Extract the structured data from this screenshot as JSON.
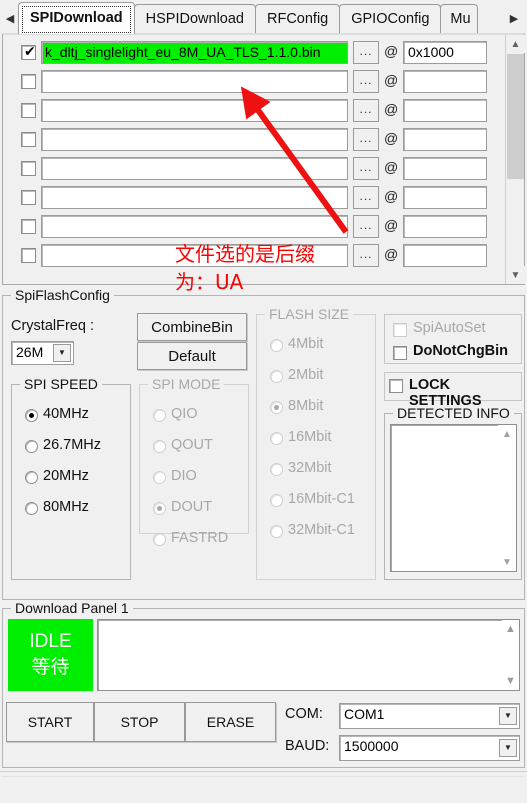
{
  "window": {
    "tab_scroll_left_icon": "triangle-left-icon",
    "tab_scroll_right_icon": "triangle-right-icon"
  },
  "tabs": [
    {
      "label": "SPIDownload",
      "active": true
    },
    {
      "label": "HSPIDownload",
      "active": false
    },
    {
      "label": "RFConfig",
      "active": false
    },
    {
      "label": "GPIOConfig",
      "active": false
    },
    {
      "label": "Mu",
      "active": false,
      "partial": true
    }
  ],
  "file_panel": {
    "browse_label": "...",
    "at_symbol": "@",
    "rows": [
      {
        "checked": true,
        "filename": "k_dltj_singlelight_eu_8M_UA_TLS_1.1.0.bin",
        "address": "0x1000",
        "highlighted": true
      },
      {
        "checked": false,
        "filename": "",
        "address": "",
        "highlighted": false
      },
      {
        "checked": false,
        "filename": "",
        "address": "",
        "highlighted": false
      },
      {
        "checked": false,
        "filename": "",
        "address": "",
        "highlighted": false
      },
      {
        "checked": false,
        "filename": "",
        "address": "",
        "highlighted": false
      },
      {
        "checked": false,
        "filename": "",
        "address": "",
        "highlighted": false
      },
      {
        "checked": false,
        "filename": "",
        "address": "",
        "highlighted": false
      },
      {
        "checked": false,
        "filename": "",
        "address": "",
        "highlighted": false
      }
    ],
    "scrollbar": {
      "up_icon": "chevron-up-icon",
      "down_icon": "chevron-down-icon"
    }
  },
  "annotation": {
    "line1": "文件选的是后缀",
    "line2": "为：UA",
    "color": "#ff0000",
    "arrow_icon": "arrow-pointer-icon"
  },
  "spiflash": {
    "title": "SpiFlashConfig",
    "crystal_freq_label": "CrystalFreq :",
    "crystal_freq_value": "26M",
    "crystal_freq_arrow_icon": "chevron-down-icon",
    "combine_bin_label": "CombineBin",
    "default_label": "Default",
    "spi_speed": {
      "title": "SPI SPEED",
      "options": [
        "40MHz",
        "26.7MHz",
        "20MHz",
        "80MHz"
      ],
      "selected": "40MHz",
      "disabled": false
    },
    "spi_mode": {
      "title": "SPI MODE",
      "options": [
        "QIO",
        "QOUT",
        "DIO",
        "DOUT",
        "FASTRD"
      ],
      "selected": "DOUT",
      "disabled": true
    },
    "flash_size": {
      "title": "FLASH SIZE",
      "options": [
        "4Mbit",
        "2Mbit",
        "8Mbit",
        "16Mbit",
        "32Mbit",
        "16Mbit-C1",
        "32Mbit-C1"
      ],
      "selected": "8Mbit",
      "disabled": true
    },
    "checkboxes": [
      {
        "label": "SpiAutoSet",
        "checked": false,
        "disabled": true
      },
      {
        "label": "DoNotChgBin",
        "checked": false,
        "disabled": false
      }
    ],
    "lock_settings": {
      "label": "LOCK SETTINGS",
      "checked": false
    },
    "detected_info": {
      "title": "DETECTED INFO",
      "content": "",
      "up_icon": "chevron-up-icon",
      "down_icon": "chevron-down-icon"
    }
  },
  "download_panel": {
    "title": "Download Panel 1",
    "status_line1": "IDLE",
    "status_line2": "等待",
    "status_color": "#00ee00",
    "log_content": "",
    "log_up_icon": "chevron-up-icon",
    "log_down_icon": "chevron-down-icon",
    "buttons": [
      "START",
      "STOP",
      "ERASE"
    ],
    "com_label": "COM:",
    "com_value": "COM1",
    "baud_label": "BAUD:",
    "baud_value": "1500000",
    "combo_arrow_icon": "chevron-down-icon"
  }
}
